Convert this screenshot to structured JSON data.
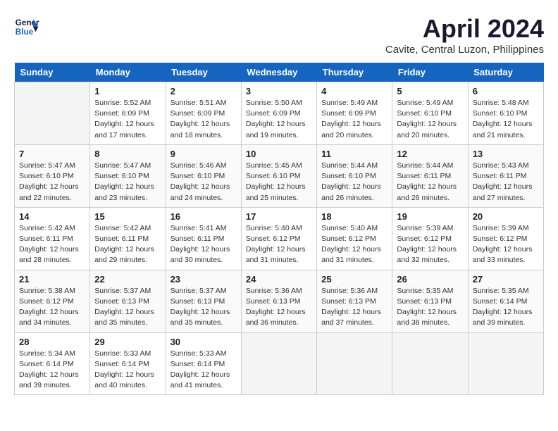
{
  "header": {
    "logo_line1": "General",
    "logo_line2": "Blue",
    "month_title": "April 2024",
    "location": "Cavite, Central Luzon, Philippines"
  },
  "days_of_week": [
    "Sunday",
    "Monday",
    "Tuesday",
    "Wednesday",
    "Thursday",
    "Friday",
    "Saturday"
  ],
  "weeks": [
    [
      {
        "day": "",
        "empty": true
      },
      {
        "day": "1",
        "sunrise": "5:52 AM",
        "sunset": "6:09 PM",
        "daylight": "12 hours and 17 minutes."
      },
      {
        "day": "2",
        "sunrise": "5:51 AM",
        "sunset": "6:09 PM",
        "daylight": "12 hours and 18 minutes."
      },
      {
        "day": "3",
        "sunrise": "5:50 AM",
        "sunset": "6:09 PM",
        "daylight": "12 hours and 19 minutes."
      },
      {
        "day": "4",
        "sunrise": "5:49 AM",
        "sunset": "6:09 PM",
        "daylight": "12 hours and 20 minutes."
      },
      {
        "day": "5",
        "sunrise": "5:49 AM",
        "sunset": "6:10 PM",
        "daylight": "12 hours and 20 minutes."
      },
      {
        "day": "6",
        "sunrise": "5:48 AM",
        "sunset": "6:10 PM",
        "daylight": "12 hours and 21 minutes."
      }
    ],
    [
      {
        "day": "7",
        "sunrise": "5:47 AM",
        "sunset": "6:10 PM",
        "daylight": "12 hours and 22 minutes."
      },
      {
        "day": "8",
        "sunrise": "5:47 AM",
        "sunset": "6:10 PM",
        "daylight": "12 hours and 23 minutes."
      },
      {
        "day": "9",
        "sunrise": "5:46 AM",
        "sunset": "6:10 PM",
        "daylight": "12 hours and 24 minutes."
      },
      {
        "day": "10",
        "sunrise": "5:45 AM",
        "sunset": "6:10 PM",
        "daylight": "12 hours and 25 minutes."
      },
      {
        "day": "11",
        "sunrise": "5:44 AM",
        "sunset": "6:10 PM",
        "daylight": "12 hours and 26 minutes."
      },
      {
        "day": "12",
        "sunrise": "5:44 AM",
        "sunset": "6:11 PM",
        "daylight": "12 hours and 26 minutes."
      },
      {
        "day": "13",
        "sunrise": "5:43 AM",
        "sunset": "6:11 PM",
        "daylight": "12 hours and 27 minutes."
      }
    ],
    [
      {
        "day": "14",
        "sunrise": "5:42 AM",
        "sunset": "6:11 PM",
        "daylight": "12 hours and 28 minutes."
      },
      {
        "day": "15",
        "sunrise": "5:42 AM",
        "sunset": "6:11 PM",
        "daylight": "12 hours and 29 minutes."
      },
      {
        "day": "16",
        "sunrise": "5:41 AM",
        "sunset": "6:11 PM",
        "daylight": "12 hours and 30 minutes."
      },
      {
        "day": "17",
        "sunrise": "5:40 AM",
        "sunset": "6:12 PM",
        "daylight": "12 hours and 31 minutes."
      },
      {
        "day": "18",
        "sunrise": "5:40 AM",
        "sunset": "6:12 PM",
        "daylight": "12 hours and 31 minutes."
      },
      {
        "day": "19",
        "sunrise": "5:39 AM",
        "sunset": "6:12 PM",
        "daylight": "12 hours and 32 minutes."
      },
      {
        "day": "20",
        "sunrise": "5:39 AM",
        "sunset": "6:12 PM",
        "daylight": "12 hours and 33 minutes."
      }
    ],
    [
      {
        "day": "21",
        "sunrise": "5:38 AM",
        "sunset": "6:12 PM",
        "daylight": "12 hours and 34 minutes."
      },
      {
        "day": "22",
        "sunrise": "5:37 AM",
        "sunset": "6:13 PM",
        "daylight": "12 hours and 35 minutes."
      },
      {
        "day": "23",
        "sunrise": "5:37 AM",
        "sunset": "6:13 PM",
        "daylight": "12 hours and 35 minutes."
      },
      {
        "day": "24",
        "sunrise": "5:36 AM",
        "sunset": "6:13 PM",
        "daylight": "12 hours and 36 minutes."
      },
      {
        "day": "25",
        "sunrise": "5:36 AM",
        "sunset": "6:13 PM",
        "daylight": "12 hours and 37 minutes."
      },
      {
        "day": "26",
        "sunrise": "5:35 AM",
        "sunset": "6:13 PM",
        "daylight": "12 hours and 38 minutes."
      },
      {
        "day": "27",
        "sunrise": "5:35 AM",
        "sunset": "6:14 PM",
        "daylight": "12 hours and 39 minutes."
      }
    ],
    [
      {
        "day": "28",
        "sunrise": "5:34 AM",
        "sunset": "6:14 PM",
        "daylight": "12 hours and 39 minutes."
      },
      {
        "day": "29",
        "sunrise": "5:33 AM",
        "sunset": "6:14 PM",
        "daylight": "12 hours and 40 minutes."
      },
      {
        "day": "30",
        "sunrise": "5:33 AM",
        "sunset": "6:14 PM",
        "daylight": "12 hours and 41 minutes."
      },
      {
        "day": "",
        "empty": true
      },
      {
        "day": "",
        "empty": true
      },
      {
        "day": "",
        "empty": true
      },
      {
        "day": "",
        "empty": true
      }
    ]
  ]
}
